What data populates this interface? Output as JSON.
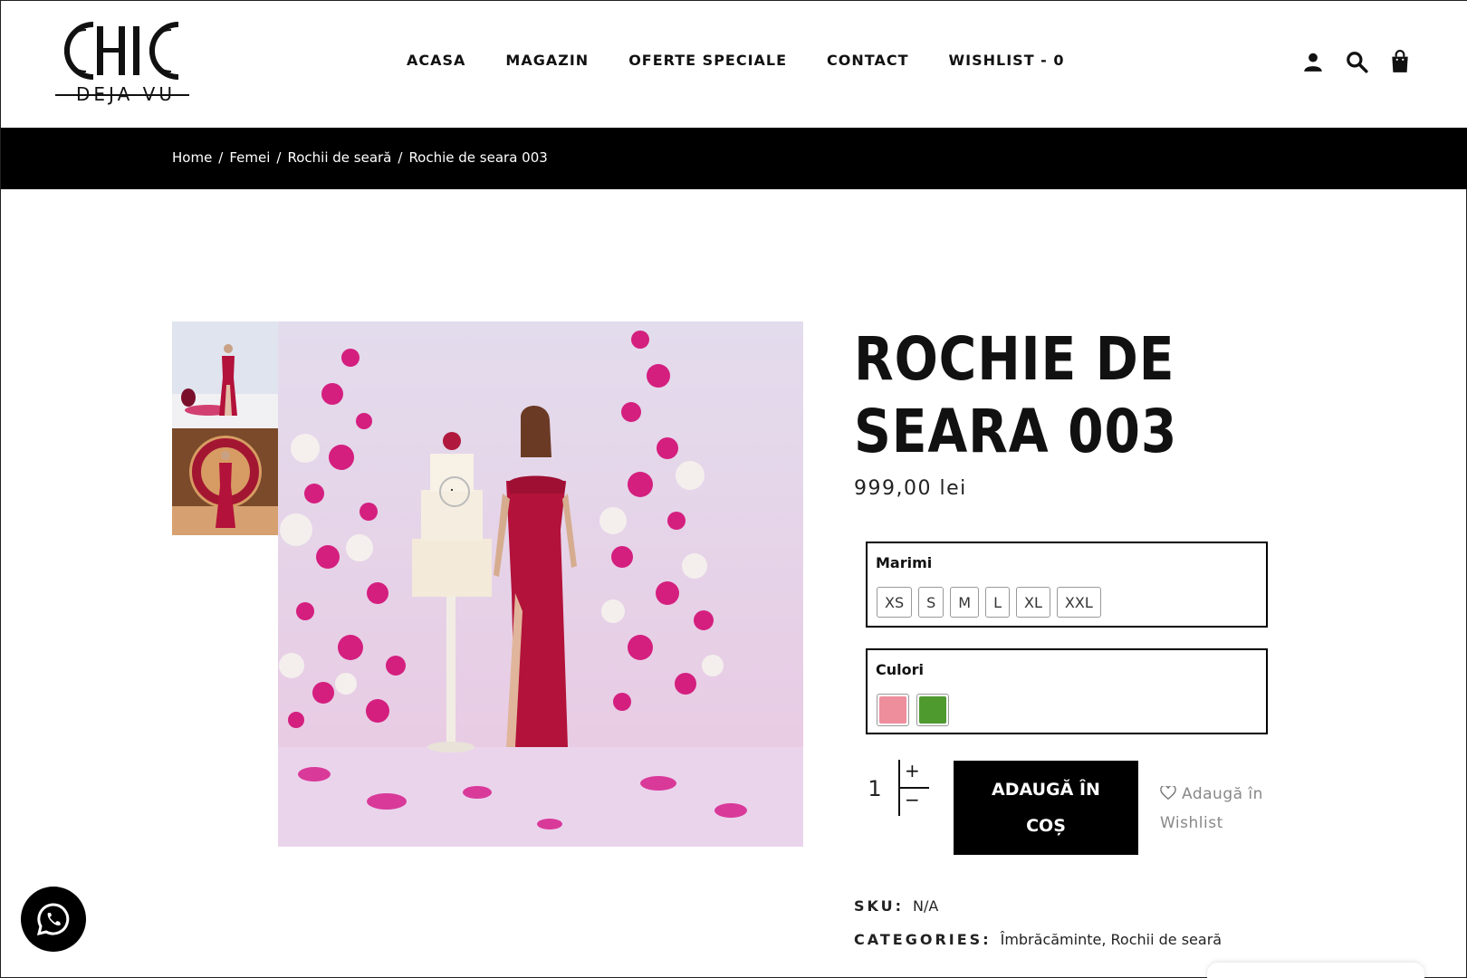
{
  "brand": {
    "logo_top": "CHIC",
    "logo_bottom": "DEJA VU"
  },
  "nav": {
    "items": [
      {
        "label": "ACASA"
      },
      {
        "label": "MAGAZIN"
      },
      {
        "label": "OFERTE SPECIALE"
      },
      {
        "label": "CONTACT"
      },
      {
        "label": "WISHLIST - 0"
      }
    ]
  },
  "header_icons": [
    "user-icon",
    "search-icon",
    "shopping-bag-icon"
  ],
  "breadcrumb": {
    "items": [
      "Home",
      "Femei",
      "Rochii de seară",
      "Rochie de seara 003"
    ],
    "separator": "/"
  },
  "product": {
    "title_line1": "ROCHIE DE",
    "title_line2": "SEARA 003",
    "price": "999,00 lei",
    "sizes_label": "Marimi",
    "sizes": [
      "XS",
      "S",
      "M",
      "L",
      "XL",
      "XXL"
    ],
    "colors_label": "Culori",
    "colors": [
      "#ee8d9c",
      "#4e9a2f"
    ],
    "quantity": "1",
    "qty_plus": "+",
    "qty_minus": "−",
    "add_to_cart_line1": "ADAUGĂ ÎN",
    "add_to_cart_line2": "COȘ",
    "wishlist_line1": "Adaugă în",
    "wishlist_line2": "Wishlist",
    "sku_label": "SKU:",
    "sku_value": "N/A",
    "categories_label": "CATEGORIES:",
    "categories": [
      "Îmbrăcăminte",
      "Rochii de seară"
    ],
    "categories_sep": ","
  },
  "colors": {
    "dress": "#b3123a",
    "flowers": "#d41f7f",
    "backdrop": "#e9dceb",
    "black": "#000000"
  }
}
